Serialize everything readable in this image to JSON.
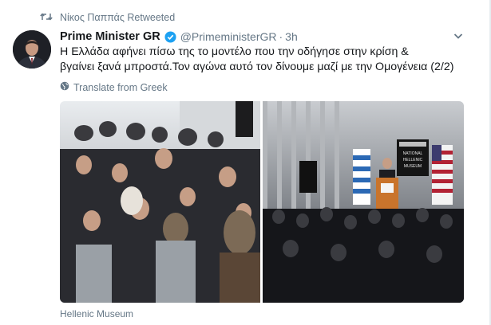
{
  "retweet": {
    "icon": "retweet-icon",
    "text": "Νίκος Παππάς Retweeted"
  },
  "tweet": {
    "author_name": "Prime Minister GR",
    "handle": "@PrimeministerGR",
    "separator": "·",
    "time": "3h",
    "verified_icon": "verified-badge-icon",
    "text_line1": "Η Ελλάδα αφήνει πίσω της το μοντέλο που την οδήγησε στην κρίση &",
    "text_line2": "βγαίνει ξανά μπροστά.Τον αγώνα αυτό τον δίνουμε μαζί με την Ομογένεια (2/2)",
    "translate_label": "Translate from Greek",
    "location": "Hellenic Museum"
  },
  "media": {
    "right_photo_sign": [
      "NATIONAL",
      "HELLENIC",
      "MUSEUM"
    ]
  },
  "colors": {
    "secondary_text": "#657786",
    "verified_blue": "#1da1f2",
    "primary_text": "#14171a"
  }
}
